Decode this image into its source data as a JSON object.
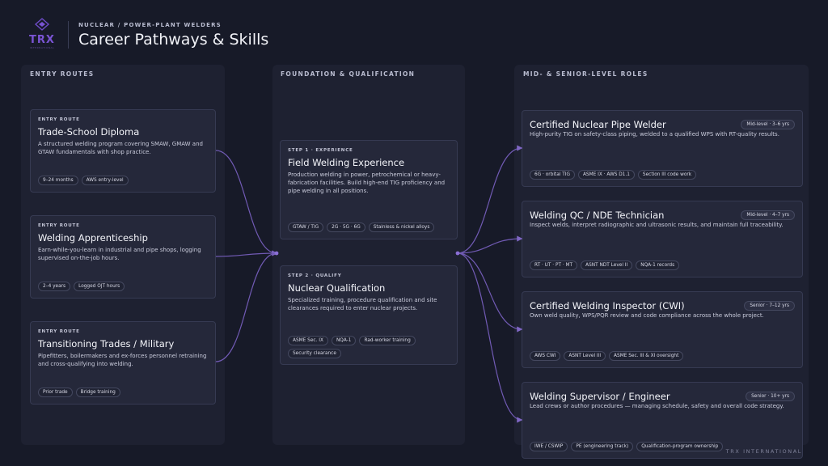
{
  "brand": {
    "logo_text": "TRX",
    "logo_sub": "INTERNATIONAL",
    "footer": "TRX INTERNATIONAL"
  },
  "header": {
    "kicker": "NUCLEAR / POWER-PLANT WELDERS",
    "title": "Career Pathways & Skills"
  },
  "colors": {
    "background": "#171a28",
    "panel": "#1e2131",
    "card": "#25283a",
    "accent": "#8b6fd6"
  },
  "columns": {
    "entry": {
      "title": "ENTRY ROUTES",
      "cards": [
        {
          "label": "ENTRY ROUTE",
          "title": "Trade-School Diploma",
          "desc": "A structured welding program covering SMAW, GMAW and GTAW fundamentals with shop practice.",
          "tags": [
            "9–24 months",
            "AWS entry-level"
          ]
        },
        {
          "label": "ENTRY ROUTE",
          "title": "Welding Apprenticeship",
          "desc": "Earn-while-you-learn in industrial and pipe shops, logging supervised on-the-job hours.",
          "tags": [
            "2–4 years",
            "Logged OJT hours"
          ]
        },
        {
          "label": "ENTRY ROUTE",
          "title": "Transitioning Trades / Military",
          "desc": "Pipefitters, boilermakers and ex-forces personnel retraining and cross-qualifying into welding.",
          "tags": [
            "Prior trade",
            "Bridge training"
          ]
        }
      ]
    },
    "foundation": {
      "title": "FOUNDATION & QUALIFICATION",
      "cards": [
        {
          "label": "STEP 1 · EXPERIENCE",
          "title": "Field Welding Experience",
          "desc": "Production welding in power, petrochemical or heavy-fabrication facilities. Build high-end TIG proficiency and pipe welding in all positions.",
          "tags": [
            "GTAW / TIG",
            "2G · 5G · 6G",
            "Stainless & nickel alloys"
          ]
        },
        {
          "label": "STEP 2 · QUALIFY",
          "title": "Nuclear Qualification",
          "desc": "Specialized training, procedure qualification and site clearances required to enter nuclear projects.",
          "tags": [
            "ASME Sec. IX",
            "NQA-1",
            "Rad-worker training",
            "Security clearance"
          ]
        }
      ]
    },
    "roles": {
      "title": "MID- & SENIOR-LEVEL ROLES",
      "cards": [
        {
          "title": "Certified Nuclear Pipe Welder",
          "badge": "Mid-level · 3–6 yrs",
          "desc": "High-purity TIG on safety-class piping, welded to a qualified WPS with RT-quality results.",
          "tags": [
            "6G · orbital TIG",
            "ASME IX · AWS D1.1",
            "Section III code work"
          ]
        },
        {
          "title": "Welding QC / NDE Technician",
          "badge": "Mid-level · 4–7 yrs",
          "desc": "Inspect welds, interpret radiographic and ultrasonic results, and maintain full traceability.",
          "tags": [
            "RT · UT · PT · MT",
            "ASNT NDT Level II",
            "NQA-1 records"
          ]
        },
        {
          "title": "Certified Welding Inspector (CWI)",
          "badge": "Senior · 7–12 yrs",
          "desc": "Own weld quality, WPS/PQR review and code compliance across the whole project.",
          "tags": [
            "AWS CWI",
            "ASNT Level III",
            "ASME Sec. III & XI oversight"
          ]
        },
        {
          "title": "Welding Supervisor / Engineer",
          "badge": "Senior · 10+ yrs",
          "desc": "Lead crews or author procedures — managing schedule, safety and overall code strategy.",
          "tags": [
            "IWE / CSWIP",
            "PE (engineering track)",
            "Qualification-program ownership"
          ]
        }
      ]
    }
  }
}
